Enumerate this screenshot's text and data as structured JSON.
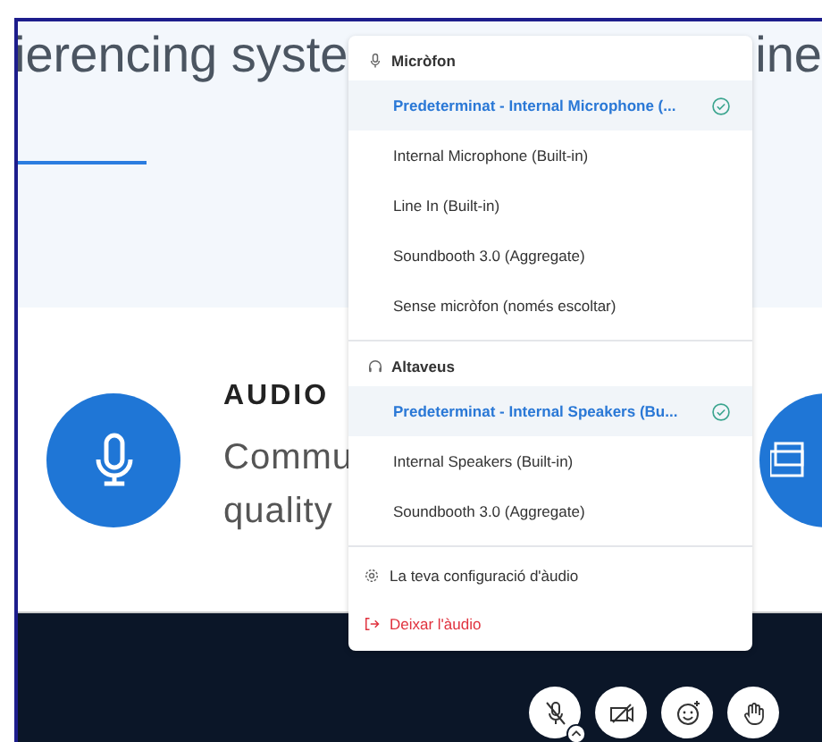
{
  "heading": {
    "left": "ierencing syste",
    "right": "ine"
  },
  "audio_card": {
    "title": "AUDIO",
    "lines": [
      "Commu",
      "quality"
    ]
  },
  "audio_menu": {
    "sections": [
      {
        "kind": "microphone",
        "title": "Micròfon",
        "items": [
          {
            "label": "Predeterminat - Internal Microphone (...",
            "selected": true
          },
          {
            "label": "Internal Microphone (Built-in)",
            "selected": false
          },
          {
            "label": "Line In (Built-in)",
            "selected": false
          },
          {
            "label": "Soundbooth 3.0 (Aggregate)",
            "selected": false
          },
          {
            "label": "Sense micròfon (només escoltar)",
            "selected": false
          }
        ]
      },
      {
        "kind": "speakers",
        "title": "Altaveus",
        "items": [
          {
            "label": "Predeterminat - Internal Speakers (Bu...",
            "selected": true
          },
          {
            "label": "Internal Speakers (Built-in)",
            "selected": false
          },
          {
            "label": "Soundbooth 3.0 (Aggregate)",
            "selected": false
          }
        ]
      }
    ],
    "actions": [
      {
        "kind": "settings",
        "label": "La teva configuració d'àudio"
      },
      {
        "kind": "leave",
        "label": "Deixar l'àudio"
      }
    ]
  },
  "toolbar": {
    "buttons": [
      {
        "kind": "mic-muted"
      },
      {
        "kind": "camera-off"
      },
      {
        "kind": "emoji"
      },
      {
        "kind": "hand"
      }
    ]
  }
}
